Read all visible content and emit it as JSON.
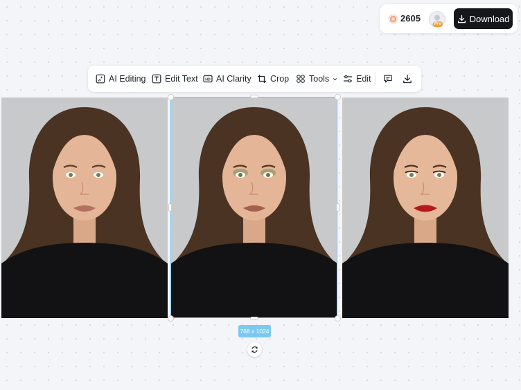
{
  "account": {
    "credits": "2605",
    "pro_badge": "Pro",
    "download_label": "Download",
    "credit_icon": "coin-icon",
    "avatar_icon": "user-avatar-icon"
  },
  "toolbar": {
    "items": [
      {
        "label": "AI Editing",
        "icon": "ai-edit-icon"
      },
      {
        "label": "Edit Text",
        "icon": "text-icon"
      },
      {
        "label": "AI Clarity",
        "icon": "hd-icon"
      },
      {
        "label": "Crop",
        "icon": "crop-icon"
      },
      {
        "label": "Tools",
        "icon": "grid-icon"
      },
      {
        "label": "Edit",
        "icon": "sliders-icon"
      }
    ],
    "comment_icon": "comment-icon",
    "download_icon": "download-icon"
  },
  "canvas": {
    "images": [
      {
        "name": "portrait-natural",
        "lip_color": "#b4705f"
      },
      {
        "name": "portrait-green-eyeshadow",
        "lip_color": "#a4604f",
        "selected": true
      },
      {
        "name": "portrait-red-lips",
        "lip_color": "#b8181c"
      }
    ],
    "selected_size": "768 x 1024",
    "rotate_icon": "rotate-icon"
  },
  "colors": {
    "accent": "#6cc3ee",
    "download_bg": "#16171b",
    "credit": "#e98a6a"
  }
}
